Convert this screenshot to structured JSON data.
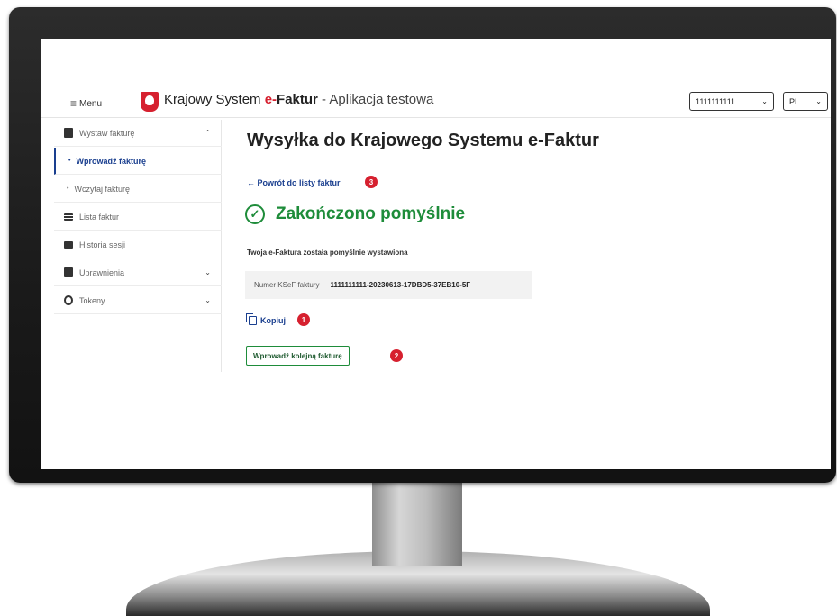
{
  "header": {
    "menu_label": "Menu",
    "brand_prefix": "Krajowy System ",
    "brand_e": "e-",
    "brand_faktur": "Faktur",
    "brand_suffix": " - Aplikacja testowa",
    "nip_selector": "1111111111",
    "lang_selector": "PL"
  },
  "sidebar": {
    "items": [
      {
        "label": "Wystaw fakturę",
        "icon": "document-icon"
      },
      {
        "label": "Wprowadź fakturę"
      },
      {
        "label": "Wczytaj fakturę"
      },
      {
        "label": "Lista faktur",
        "icon": "list-icon"
      },
      {
        "label": "Historia sesji",
        "icon": "mail-icon"
      },
      {
        "label": "Uprawnienia",
        "icon": "document-icon"
      },
      {
        "label": "Tokeny",
        "icon": "circle-icon"
      }
    ]
  },
  "main": {
    "title": "Wysyłka do Krajowego Systemu e-Faktur",
    "back_link": "← Powrót do listy faktur",
    "success": "Zakończono pomyślnie",
    "description": "Twoja e-Faktura została pomyślnie wystawiona",
    "ksef_label": "Numer KSeF faktury",
    "ksef_value": "1111111111-20230613-17DBD5-37EB10-5F",
    "copy_label": "Kopiuj",
    "next_button": "Wprowadź kolejną fakturę"
  },
  "badges": {
    "back": "3",
    "copy": "1",
    "next": "2"
  },
  "colors": {
    "accent_blue": "#1a3f8f",
    "success_green": "#1e8c3a",
    "badge_red": "#d6202f",
    "brand_red": "#d6202f"
  }
}
